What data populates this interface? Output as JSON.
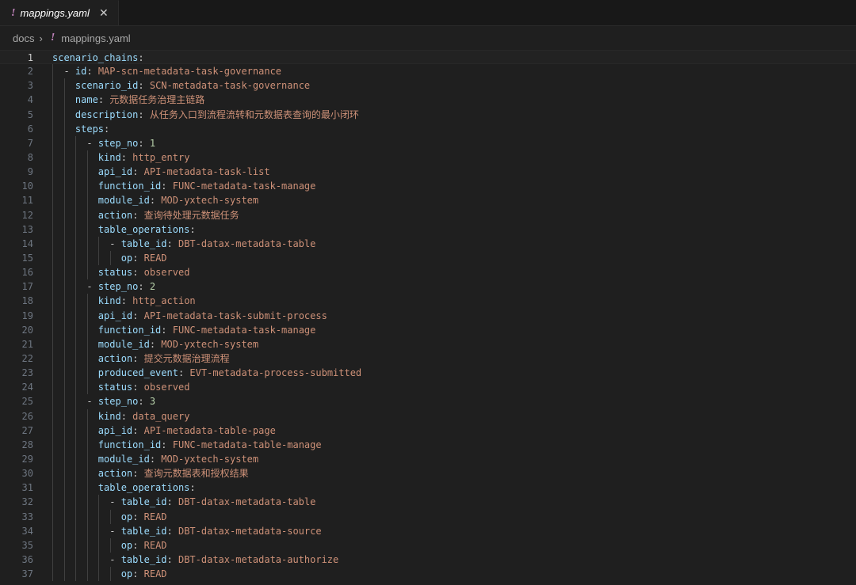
{
  "tab": {
    "icon": "yaml-exclamation-icon",
    "bang": "!",
    "title": "mappings.yaml",
    "close": "✕"
  },
  "breadcrumb": {
    "folder": "docs",
    "separator": "›",
    "bang": "!",
    "file": "mappings.yaml"
  },
  "editor": {
    "current_line": 1,
    "lines": [
      {
        "n": "1",
        "indent": 0,
        "key": "scenario_chains",
        "val": ""
      },
      {
        "n": "2",
        "indent": 1,
        "dash": true,
        "key": "id",
        "val": "MAP-scn-metadata-task-governance"
      },
      {
        "n": "3",
        "indent": 2,
        "key": "scenario_id",
        "val": "SCN-metadata-task-governance"
      },
      {
        "n": "4",
        "indent": 2,
        "key": "name",
        "val": "元数据任务治理主链路"
      },
      {
        "n": "5",
        "indent": 2,
        "key": "description",
        "val": "从任务入口到流程流转和元数据表查询的最小闭环"
      },
      {
        "n": "6",
        "indent": 2,
        "key": "steps",
        "val": ""
      },
      {
        "n": "7",
        "indent": 3,
        "dash": true,
        "key": "step_no",
        "val": "1",
        "num": true
      },
      {
        "n": "8",
        "indent": 4,
        "key": "kind",
        "val": "http_entry"
      },
      {
        "n": "9",
        "indent": 4,
        "key": "api_id",
        "val": "API-metadata-task-list"
      },
      {
        "n": "10",
        "indent": 4,
        "key": "function_id",
        "val": "FUNC-metadata-task-manage"
      },
      {
        "n": "11",
        "indent": 4,
        "key": "module_id",
        "val": "MOD-yxtech-system"
      },
      {
        "n": "12",
        "indent": 4,
        "key": "action",
        "val": "查询待处理元数据任务"
      },
      {
        "n": "13",
        "indent": 4,
        "key": "table_operations",
        "val": ""
      },
      {
        "n": "14",
        "indent": 5,
        "dash": true,
        "key": "table_id",
        "val": "DBT-datax-metadata-table"
      },
      {
        "n": "15",
        "indent": 6,
        "key": "op",
        "val": "READ"
      },
      {
        "n": "16",
        "indent": 4,
        "key": "status",
        "val": "observed"
      },
      {
        "n": "17",
        "indent": 3,
        "dash": true,
        "key": "step_no",
        "val": "2",
        "num": true
      },
      {
        "n": "18",
        "indent": 4,
        "key": "kind",
        "val": "http_action"
      },
      {
        "n": "19",
        "indent": 4,
        "key": "api_id",
        "val": "API-metadata-task-submit-process"
      },
      {
        "n": "20",
        "indent": 4,
        "key": "function_id",
        "val": "FUNC-metadata-task-manage"
      },
      {
        "n": "21",
        "indent": 4,
        "key": "module_id",
        "val": "MOD-yxtech-system"
      },
      {
        "n": "22",
        "indent": 4,
        "key": "action",
        "val": "提交元数据治理流程"
      },
      {
        "n": "23",
        "indent": 4,
        "key": "produced_event",
        "val": "EVT-metadata-process-submitted"
      },
      {
        "n": "24",
        "indent": 4,
        "key": "status",
        "val": "observed"
      },
      {
        "n": "25",
        "indent": 3,
        "dash": true,
        "key": "step_no",
        "val": "3",
        "num": true
      },
      {
        "n": "26",
        "indent": 4,
        "key": "kind",
        "val": "data_query"
      },
      {
        "n": "27",
        "indent": 4,
        "key": "api_id",
        "val": "API-metadata-table-page"
      },
      {
        "n": "28",
        "indent": 4,
        "key": "function_id",
        "val": "FUNC-metadata-table-manage"
      },
      {
        "n": "29",
        "indent": 4,
        "key": "module_id",
        "val": "MOD-yxtech-system"
      },
      {
        "n": "30",
        "indent": 4,
        "key": "action",
        "val": "查询元数据表和授权结果"
      },
      {
        "n": "31",
        "indent": 4,
        "key": "table_operations",
        "val": ""
      },
      {
        "n": "32",
        "indent": 5,
        "dash": true,
        "key": "table_id",
        "val": "DBT-datax-metadata-table"
      },
      {
        "n": "33",
        "indent": 6,
        "key": "op",
        "val": "READ"
      },
      {
        "n": "34",
        "indent": 5,
        "dash": true,
        "key": "table_id",
        "val": "DBT-datax-metadata-source"
      },
      {
        "n": "35",
        "indent": 6,
        "key": "op",
        "val": "READ"
      },
      {
        "n": "36",
        "indent": 5,
        "dash": true,
        "key": "table_id",
        "val": "DBT-datax-metadata-authorize"
      },
      {
        "n": "37",
        "indent": 6,
        "key": "op",
        "val": "READ"
      }
    ]
  }
}
